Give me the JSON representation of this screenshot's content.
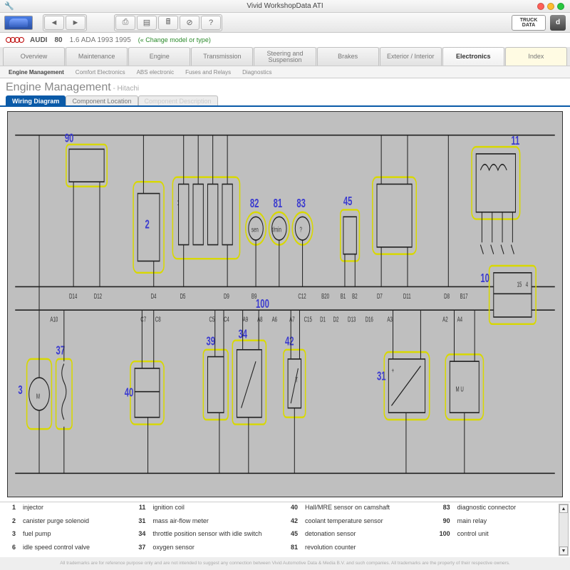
{
  "window": {
    "title": "Vivid WorkshopData ATI"
  },
  "toolbar": {
    "logo_right_label": "TRUCK\nDATA",
    "d_badge": "d"
  },
  "vehicle": {
    "brand": "AUDI",
    "model": "80",
    "variant": "1.6 ADA 1993 1995",
    "change_link": "(« Change model or type)"
  },
  "main_tabs": [
    "Overview",
    "Maintenance",
    "Engine",
    "Transmission",
    "Steering and Suspension",
    "Brakes",
    "Exterior / Interior",
    "Electronics",
    "Index"
  ],
  "main_tab_active": 7,
  "sub_tabs": [
    "Engine Management",
    "Comfort Electronics",
    "ABS electronic",
    "Fuses and Relays",
    "Diagnostics"
  ],
  "sub_tab_active": 0,
  "section": {
    "title": "Engine Management",
    "suffix": " - Hitachi"
  },
  "doc_tabs": [
    {
      "label": "Wiring Diagram",
      "state": "active"
    },
    {
      "label": "Component Location",
      "state": "normal"
    },
    {
      "label": "Component Description",
      "state": "disabled"
    }
  ],
  "diagram_labels": {
    "n90": "90",
    "n2": "2",
    "n82": "82",
    "n81": "81",
    "n83": "83",
    "n45": "45",
    "n11": "11",
    "n10": "10",
    "n3": "3",
    "n37": "37",
    "n40": "40",
    "n39": "39",
    "n34": "34",
    "n42": "42",
    "n31": "31",
    "n100": "100",
    "t_D14": "D14",
    "t_D12": "D12",
    "t_D4": "D4",
    "t_D5": "D5",
    "t_D9": "D9",
    "t_B9": "B9",
    "t_C12": "C12",
    "t_B20": "B20",
    "t_B1": "B1",
    "t_B2": "B2",
    "t_D7": "D7",
    "t_D11": "D11",
    "t_D8": "D8",
    "t_B17": "B17",
    "t_15": "15",
    "t_4": "4",
    "t_A10": "A10",
    "t_C7": "C7",
    "t_C8": "C8",
    "t_C5": "C5",
    "t_C4": "C4",
    "t_A9": "A9",
    "t_A8": "A8",
    "t_A6": "A6",
    "t_A7": "A7",
    "t_C15": "C15",
    "t_D1": "D1",
    "t_D2": "D2",
    "t_D13": "D13",
    "t_D16": "D16",
    "t_A3": "A3",
    "t_A2": "A2",
    "t_A4": "A4",
    "t_1": "1",
    "t_sen": "sen",
    "t_tmin": "t/min",
    "t_q": "?",
    "t_M": "M",
    "t_MU": "M U",
    "t_plus": "+",
    "t_T": "T"
  },
  "legend": [
    {
      "n": "1",
      "d": "injector"
    },
    {
      "n": "2",
      "d": "canister purge solenoid"
    },
    {
      "n": "3",
      "d": "fuel pump"
    },
    {
      "n": "6",
      "d": "idle speed control valve"
    },
    {
      "n": "11",
      "d": "ignition coil"
    },
    {
      "n": "31",
      "d": "mass air-flow meter"
    },
    {
      "n": "34",
      "d": "throttle position sensor with idle switch"
    },
    {
      "n": "37",
      "d": "oxygen sensor"
    },
    {
      "n": "40",
      "d": "Hall/MRE sensor on camshaft"
    },
    {
      "n": "42",
      "d": "coolant temperature sensor"
    },
    {
      "n": "45",
      "d": "detonation sensor"
    },
    {
      "n": "81",
      "d": "revolution counter"
    },
    {
      "n": "83",
      "d": "diagnostic connector"
    },
    {
      "n": "90",
      "d": "main relay"
    },
    {
      "n": "100",
      "d": "control unit"
    }
  ],
  "footer": "All trademarks are for reference purpose only and are not intended to suggest any connection between Vivid Automotive Data & Media B.V. and such companies. All trademarks are the property of their respective owners."
}
